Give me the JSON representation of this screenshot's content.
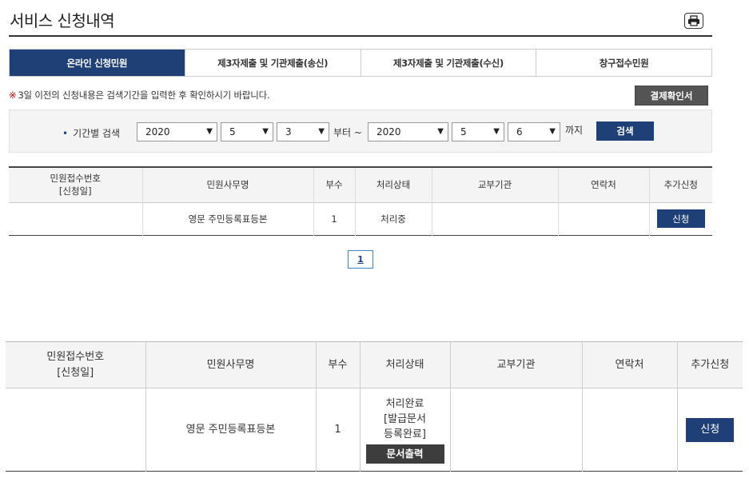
{
  "header": {
    "title": "서비스 신청내역",
    "print_icon": "printer-icon"
  },
  "tabs": [
    {
      "label": "온라인 신청민원",
      "active": true
    },
    {
      "label": "제3자제출 및 기관제출(송신)",
      "active": false
    },
    {
      "label": "제3자제출 및 기관제출(수신)",
      "active": false
    },
    {
      "label": "창구접수민원",
      "active": false
    }
  ],
  "notice": {
    "mark": "※",
    "text": "3일 이전의 신청내용은 검색기간을 입력한 후 확인하시기 바랍니다."
  },
  "receipt_button": "결제확인서",
  "search": {
    "label": "기간별 검색",
    "from": {
      "year": "2020",
      "month": "5",
      "day": "3"
    },
    "from_suffix": "부터 ~",
    "to": {
      "year": "2020",
      "month": "5",
      "day": "6"
    },
    "to_suffix": "까지",
    "button": "검색"
  },
  "table_small": {
    "headers": [
      "민원접수번호",
      "[신청일]",
      "민원사무명",
      "부수",
      "처리상태",
      "교부기관",
      "연락처",
      "추가신청"
    ],
    "rows": [
      {
        "receipt_no": "",
        "name": "영문 주민등록표등본",
        "copies": "1",
        "status": "처리중",
        "agency": "",
        "contact": "",
        "action": "신청"
      }
    ]
  },
  "pagination": {
    "current": "1"
  },
  "table_large": {
    "headers": [
      "민원접수번호",
      "[신청일]",
      "민원사무명",
      "부수",
      "처리상태",
      "교부기관",
      "연락처",
      "추가신청"
    ],
    "rows": [
      {
        "receipt_no": "",
        "name": "영문 주민등록표등본",
        "copies": "1",
        "status_line1": "처리완료",
        "status_line2": "[발급문서",
        "status_line3": "등록완료]",
        "print_button": "문서출력",
        "agency": "",
        "contact": "",
        "action": "신청"
      }
    ]
  },
  "colors": {
    "accent": "#1e4077",
    "dark_button": "#545454",
    "header_bg": "#f4f4f4"
  }
}
